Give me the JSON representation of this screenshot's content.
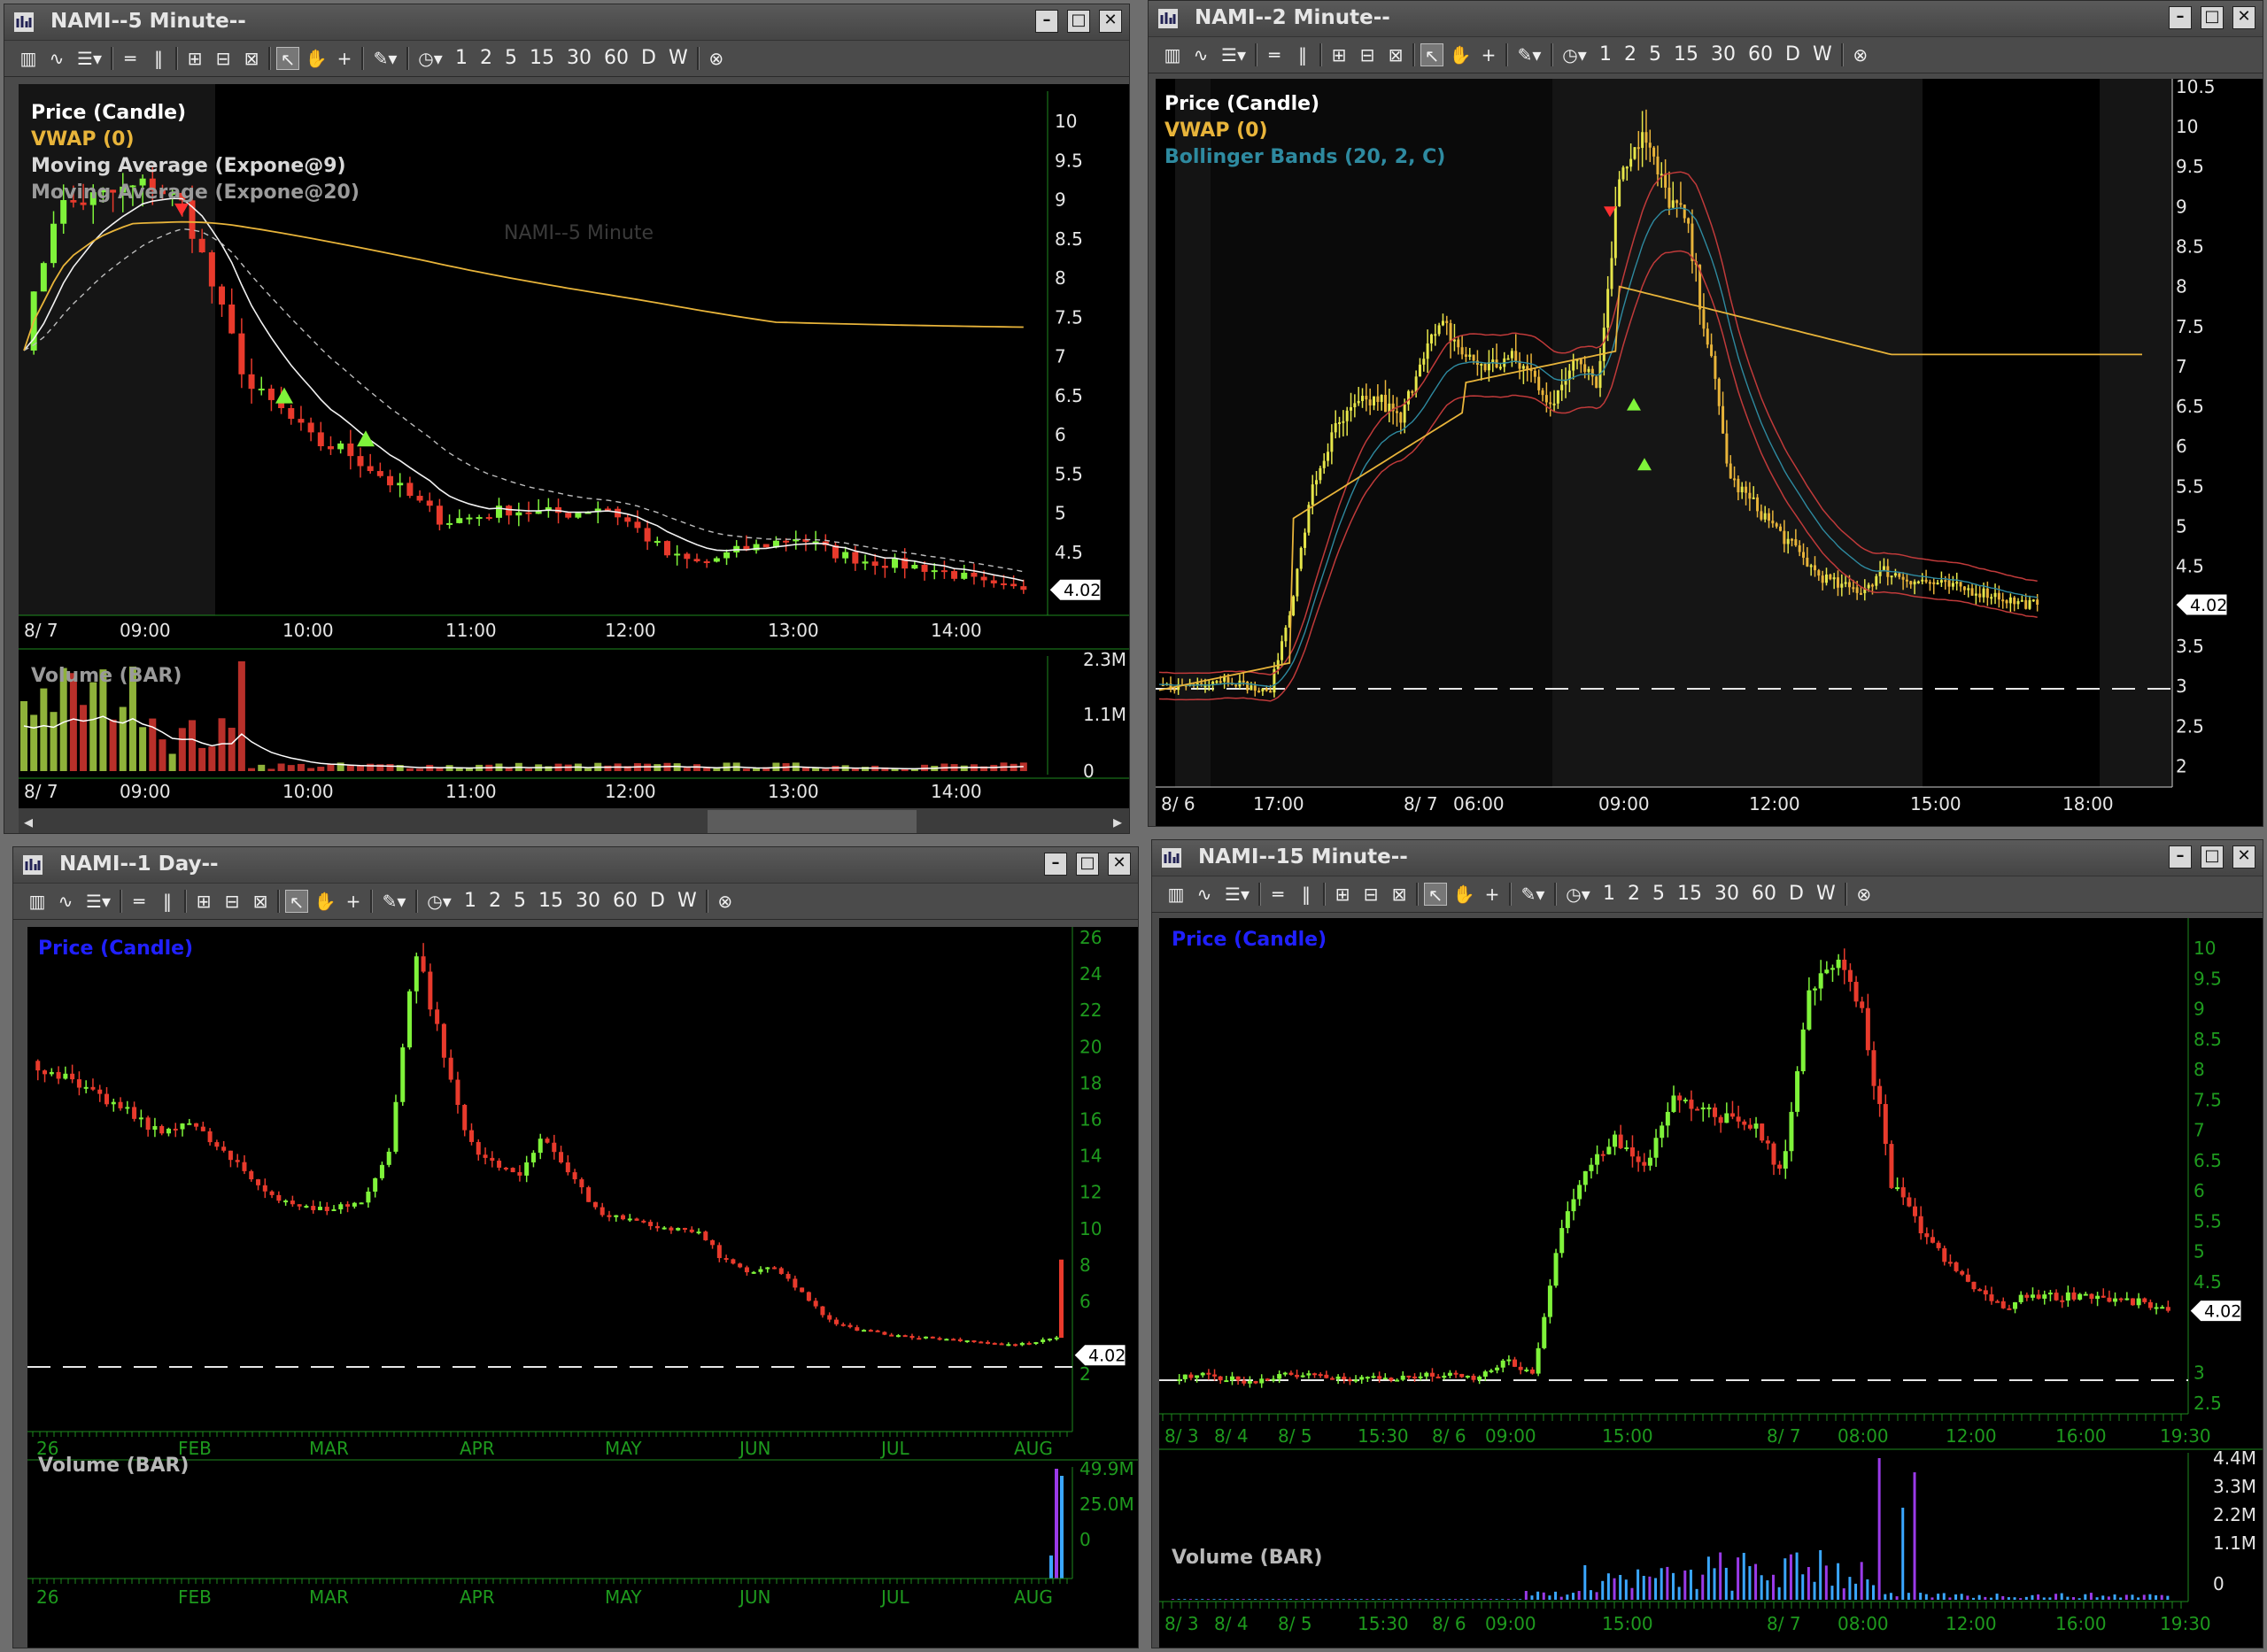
{
  "colors": {
    "up": "#7ff33a",
    "down": "#e83a2c",
    "vwap": "#e8b43a",
    "ma9": "#f2f2f2",
    "ma20": "#bdbdbd",
    "bb": "#c03a3a",
    "bblabel": "#2e8aa0",
    "axisgreen": "#1e8a1e",
    "vol15a": "#3aa7ff",
    "vol15b": "#9a3ae8",
    "blue_label": "#2020ff"
  },
  "toolbar": {
    "timeframes": [
      "1",
      "2",
      "5",
      "15",
      "30",
      "60",
      "D",
      "W"
    ]
  },
  "w5": {
    "title": "NAMI--5 Minute--",
    "legend": [
      "Price (Candle)",
      "VWAP (0)",
      "Moving Average (Expone@9)",
      "Moving Average (Expone@20)"
    ],
    "watermark": "NAMI--5 Minute",
    "price_ticks": [
      "10",
      "9.5",
      "9",
      "8.5",
      "8",
      "7.5",
      "7",
      "6.5",
      "6",
      "5.5",
      "5",
      "4.5"
    ],
    "last_price": "4.02",
    "time_labels": [
      "8/ 7",
      "09:00",
      "10:00",
      "11:00",
      "12:00",
      "13:00",
      "14:00"
    ],
    "volume_label": "Volume (BAR)",
    "volume_ticks": [
      "2.3M",
      "1.1M",
      "0"
    ]
  },
  "w2": {
    "title": "NAMI--2 Minute--",
    "legend": [
      "Price (Candle)",
      "VWAP (0)",
      "Bollinger Bands (20, 2, C)"
    ],
    "price_ticks": [
      "10.5",
      "10",
      "9.5",
      "9",
      "8.5",
      "8",
      "7.5",
      "7",
      "6.5",
      "6",
      "5.5",
      "5",
      "4.5",
      "3.5",
      "3",
      "2.5",
      "2"
    ],
    "last_price": "4.02",
    "time_labels": [
      "8/ 6",
      "17:00",
      "8/ 7",
      "06:00",
      "09:00",
      "12:00",
      "15:00",
      "18:00"
    ]
  },
  "wd": {
    "title": "NAMI--1 Day--",
    "legend": [
      "Price (Candle)"
    ],
    "price_ticks": [
      "26",
      "24",
      "22",
      "20",
      "18",
      "16",
      "14",
      "12",
      "10",
      "8",
      "6",
      "2"
    ],
    "last_price": "4.02",
    "month_labels": [
      "26",
      "FEB",
      "MAR",
      "APR",
      "MAY",
      "JUN",
      "JUL",
      "AUG"
    ],
    "volume_label": "Volume (BAR)",
    "volume_ticks": [
      "49.9M",
      "25.0M",
      "0"
    ]
  },
  "w15": {
    "title": "NAMI--15 Minute--",
    "legend": [
      "Price (Candle)"
    ],
    "price_ticks": [
      "10",
      "9.5",
      "9",
      "8.5",
      "8",
      "7.5",
      "7",
      "6.5",
      "6",
      "5.5",
      "5",
      "4.5",
      "3",
      "2.5"
    ],
    "last_price": "4.02",
    "time_labels": [
      "8/ 3",
      "8/ 4",
      "8/ 5",
      "15:30",
      "8/ 6",
      "09:00",
      "15:00",
      "8/ 7",
      "08:00",
      "12:00",
      "16:00",
      "19:30"
    ],
    "volume_label": "Volume (BAR)",
    "volume_ticks": [
      "4.4M",
      "3.3M",
      "2.2M",
      "1.1M",
      "0"
    ]
  }
}
